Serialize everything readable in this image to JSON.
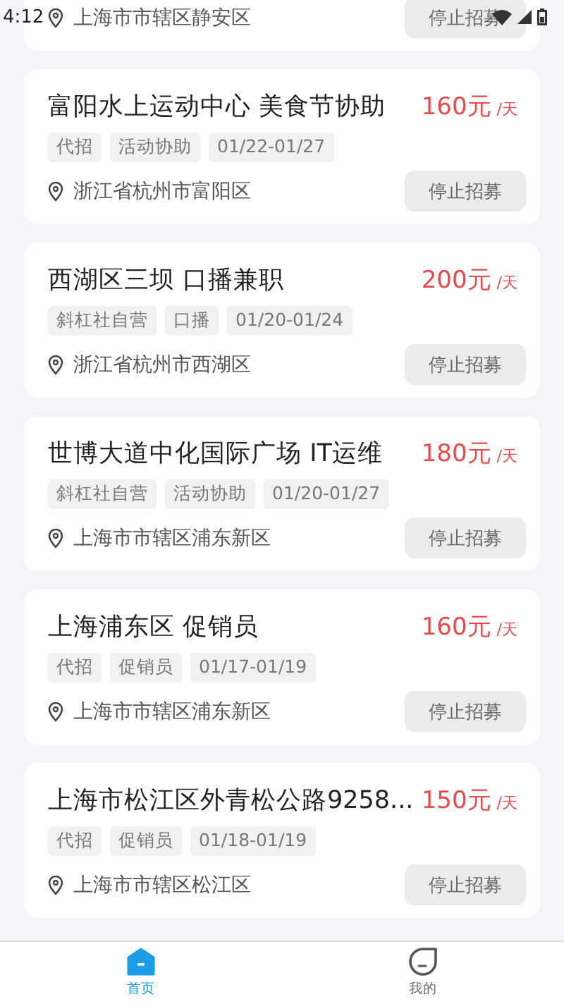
{
  "status_bar": {
    "time": "4:12"
  },
  "partial_card": {
    "location": "上海市市辖区静安区",
    "button": "停止招募"
  },
  "jobs": [
    {
      "title": "富阳水上运动中心 美食节协助",
      "price": "160元",
      "unit": "/天",
      "tags": [
        "代招",
        "活动协助",
        "01/22-01/27"
      ],
      "location": "浙江省杭州市富阳区",
      "button": "停止招募"
    },
    {
      "title": "西湖区三坝 口播兼职",
      "price": "200元",
      "unit": "/天",
      "tags": [
        "斜杠社自营",
        "口播",
        "01/20-01/24"
      ],
      "location": "浙江省杭州市西湖区",
      "button": "停止招募"
    },
    {
      "title": "世博大道中化国际广场 IT运维",
      "price": "180元",
      "unit": "/天",
      "tags": [
        "斜杠社自营",
        "活动协助",
        "01/20-01/27"
      ],
      "location": "上海市市辖区浦东新区",
      "button": "停止招募"
    },
    {
      "title": "上海浦东区 促销员",
      "price": "160元",
      "unit": "/天",
      "tags": [
        "代招",
        "促销员",
        "01/17-01/19"
      ],
      "location": "上海市市辖区浦东新区",
      "button": "停止招募"
    },
    {
      "title": "上海市松江区外青松公路9258...",
      "price": "150元",
      "unit": "/天",
      "tags": [
        "代招",
        "促销员",
        "01/18-01/19"
      ],
      "location": "上海市市辖区松江区",
      "button": "停止招募"
    }
  ],
  "tab_bar": [
    {
      "label": "首页",
      "kind": "home",
      "selected": true
    },
    {
      "label": "我的",
      "kind": "profile",
      "selected": false
    }
  ]
}
